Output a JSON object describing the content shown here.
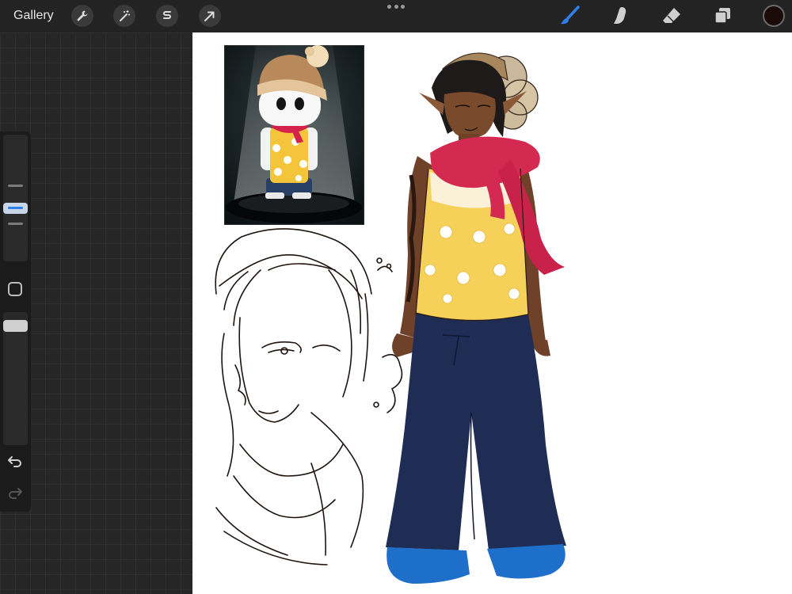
{
  "topbar": {
    "gallery_label": "Gallery",
    "left_tools": [
      {
        "name": "actions",
        "icon": "wrench-icon"
      },
      {
        "name": "adjustments",
        "icon": "magic-wand-icon"
      },
      {
        "name": "selection",
        "icon": "selection-s-icon"
      },
      {
        "name": "transform",
        "icon": "arrow-cursor-icon"
      }
    ],
    "right_tools": [
      {
        "name": "brush",
        "icon": "brush-icon",
        "active": true
      },
      {
        "name": "smudge",
        "icon": "smudge-finger-icon",
        "active": false
      },
      {
        "name": "eraser",
        "icon": "eraser-icon",
        "active": false
      },
      {
        "name": "layers",
        "icon": "layers-icon",
        "active": false
      }
    ],
    "current_color": "#1a0a08"
  },
  "sidebar": {
    "brush_size_icon": "size-slider",
    "modify_icon": "square-modify-icon",
    "opacity_icon": "opacity-slider",
    "undo_icon": "undo-icon",
    "redo_icon": "redo-icon"
  },
  "colors": {
    "accent": "#2f80ed",
    "toolbar_bg": "#232323",
    "canvas_bg": "#ffffff",
    "scarf": "#d42a52",
    "shirt": "#f6d15a",
    "pants": "#1f2d55",
    "shoes": "#1e6fc9",
    "skin": "#7a4a2c"
  }
}
